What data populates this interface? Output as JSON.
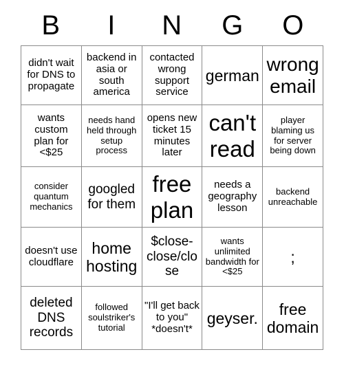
{
  "card": {
    "header_letters": [
      "B",
      "I",
      "N",
      "G",
      "O"
    ],
    "rows": [
      [
        {
          "text": "didn't wait for DNS to propagate",
          "size": "t-md"
        },
        {
          "text": "backend in asia or south america",
          "size": "t-md"
        },
        {
          "text": "contacted wrong support service",
          "size": "t-md"
        },
        {
          "text": "german",
          "size": "t-xl"
        },
        {
          "text": "wrong email",
          "size": "t-xxl"
        }
      ],
      [
        {
          "text": "wants custom plan for <$25",
          "size": "t-md"
        },
        {
          "text": "needs hand held through setup process",
          "size": "t-sm"
        },
        {
          "text": "opens new ticket 15 minutes later",
          "size": "t-md"
        },
        {
          "text": "can't read",
          "size": "t-huge"
        },
        {
          "text": "player blaming us for server being down",
          "size": "t-sm"
        }
      ],
      [
        {
          "text": "consider quantum mechanics",
          "size": "t-sm"
        },
        {
          "text": "googled for them",
          "size": "t-lg"
        },
        {
          "text": "free plan",
          "size": "t-huge"
        },
        {
          "text": "needs a geography lesson",
          "size": "t-md"
        },
        {
          "text": "backend unreachable",
          "size": "t-sm"
        }
      ],
      [
        {
          "text": "doesn't use cloudflare",
          "size": "t-md"
        },
        {
          "text": "home hosting",
          "size": "t-xl"
        },
        {
          "text": "$close-close/close",
          "size": "t-lg"
        },
        {
          "text": "wants unlimited bandwidth for <$25",
          "size": "t-sm"
        },
        {
          "text": ";",
          "size": "t-xl"
        }
      ],
      [
        {
          "text": "deleted DNS records",
          "size": "t-lg"
        },
        {
          "text": "followed soulstriker's tutorial",
          "size": "t-sm"
        },
        {
          "text": "\"I'll get back to you\" *doesn't*",
          "size": "t-md"
        },
        {
          "text": "geyser.",
          "size": "t-xl"
        },
        {
          "text": "free domain",
          "size": "t-xl"
        }
      ]
    ]
  }
}
